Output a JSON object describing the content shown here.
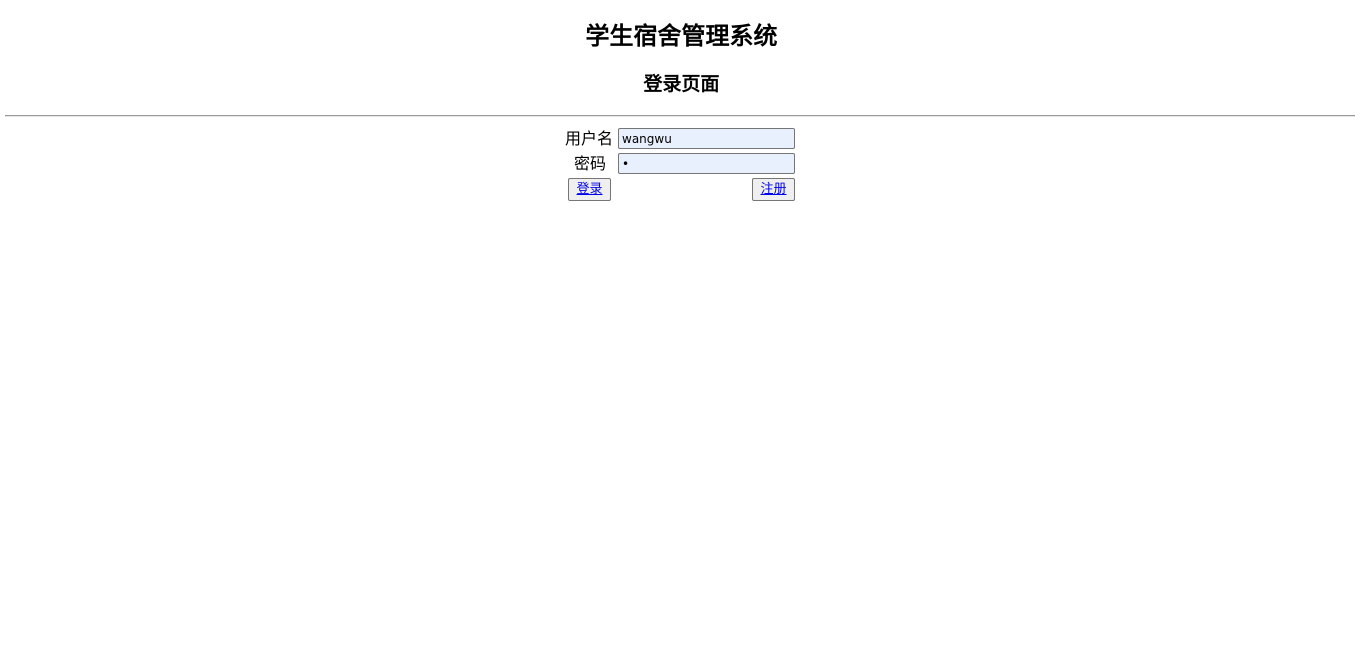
{
  "header": {
    "title": "学生宿舍管理系统",
    "subtitle": "登录页面"
  },
  "form": {
    "username_label": "用户名",
    "username_value": "wangwu",
    "password_label": "密码",
    "password_value": "1",
    "login_label": "登录",
    "register_label": "注册"
  },
  "colors": {
    "link": "#0000ee",
    "field_background": "#e8f0fe"
  }
}
